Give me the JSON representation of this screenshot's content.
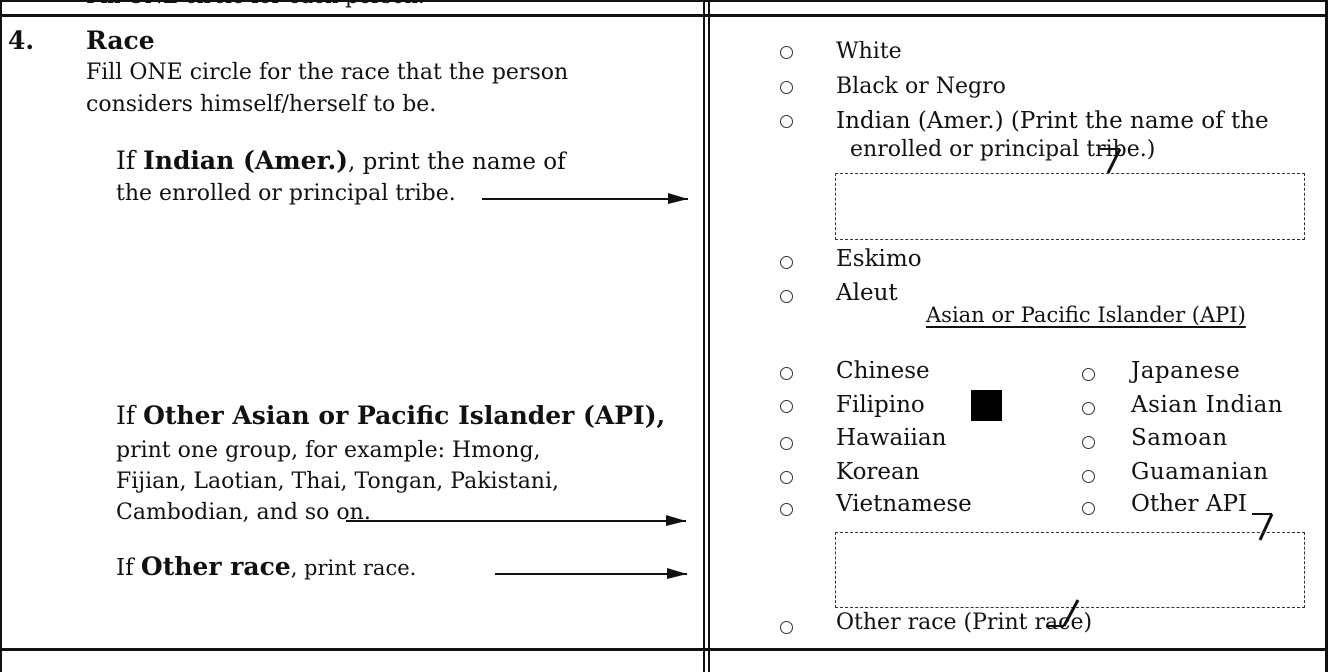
{
  "top_fragment": "Fill ONE circle for each person.",
  "question": {
    "number": "4.",
    "title": "Race",
    "instruction_line1": "Fill ONE circle for the race that the person",
    "instruction_line2": "considers himself/herself to be.",
    "indian_if": "If ",
    "indian_term": "Indian (Amer.)",
    "indian_rest": ", print the name of",
    "indian_line2": "the enrolled or principal tribe.",
    "api_if": "If ",
    "api_term": "Other Asian or Pacific Islander (API),",
    "api_line2": "print one group, for example: Hmong,",
    "api_line3": "Fijian, Laotian, Thai, Tongan, Pakistani,",
    "api_line4": "Cambodian, and so on.",
    "other_if": "If ",
    "other_term": "Other race",
    "other_rest": ", print race."
  },
  "options": {
    "white": "White",
    "black": "Black or Negro",
    "indian_line1": "Indian (Amer.) (Print the name of the",
    "indian_line2": "enrolled or principal tribe.)",
    "eskimo": "Eskimo",
    "aleut": "Aleut",
    "api_header": "Asian or Pacific Islander (API)",
    "chinese": "Chinese",
    "filipino": "Filipino",
    "hawaiian": "Hawaiian",
    "korean": "Korean",
    "vietnamese": "Vietnamese",
    "japanese": "Japanese",
    "asian_indian": "Asian Indian",
    "samoan": "Samoan",
    "guamanian": "Guamanian",
    "other_api": "Other API",
    "other_race": "Other race (Print race)"
  }
}
